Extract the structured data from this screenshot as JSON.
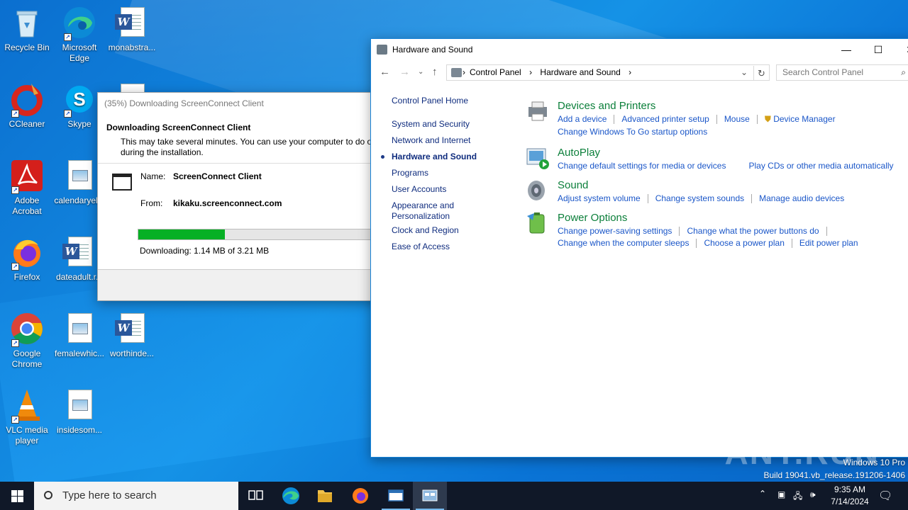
{
  "desktop": {
    "icons": [
      {
        "label": "Recycle Bin"
      },
      {
        "label": "Microsoft Edge"
      },
      {
        "label": "monabstra..."
      },
      {
        "label": "CCleaner"
      },
      {
        "label": "Skype"
      },
      {
        "label": "Adobe Acrobat"
      },
      {
        "label": "calendaryel..."
      },
      {
        "label": "Firefox"
      },
      {
        "label": "dateadult.r..."
      },
      {
        "label": "Google Chrome"
      },
      {
        "label": "femalewhic..."
      },
      {
        "label": "worthinde..."
      },
      {
        "label": "VLC media player"
      },
      {
        "label": "insidesom..."
      }
    ]
  },
  "download_dialog": {
    "title": "(35%) Downloading ScreenConnect Client",
    "heading": "Downloading ScreenConnect Client",
    "subtitle_line1": "This may take several minutes. You can use your computer to do ot",
    "subtitle_line2": "during the installation.",
    "name_label": "Name:",
    "name_value": "ScreenConnect Client",
    "from_label": "From:",
    "from_value": "kikaku.screenconnect.com",
    "progress_percent": 35,
    "status": "Downloading: 1.14 MB of 3.21 MB"
  },
  "control_panel": {
    "title": "Hardware and Sound",
    "breadcrumb": [
      "Control Panel",
      "Hardware and Sound"
    ],
    "search_placeholder": "Search Control Panel",
    "sidebar": {
      "home": "Control Panel Home",
      "items": [
        "System and Security",
        "Network and Internet",
        "Hardware and Sound",
        "Programs",
        "User Accounts",
        "Appearance and Personalization",
        "Clock and Region",
        "Ease of Access"
      ],
      "active_index": 2
    },
    "categories": [
      {
        "title": "Devices and Printers",
        "row1": [
          "Add a device",
          "Advanced printer setup",
          "Mouse",
          "Device Manager"
        ],
        "row2": [
          "Change Windows To Go startup options"
        ]
      },
      {
        "title": "AutoPlay",
        "row1": [
          "Change default settings for media or devices",
          "Play CDs or other media automatically"
        ],
        "row2": []
      },
      {
        "title": "Sound",
        "row1": [
          "Adjust system volume",
          "Change system sounds",
          "Manage audio devices"
        ],
        "row2": []
      },
      {
        "title": "Power Options",
        "row1": [
          "Change power-saving settings",
          "Change what the power buttons do"
        ],
        "row2": [
          "Change when the computer sleeps",
          "Choose a power plan",
          "Edit power plan"
        ]
      }
    ]
  },
  "watermark": {
    "text": "ANY.RUN",
    "edition": "Windows 10 Pro",
    "build": "Build 19041.vb_release.191206-1406"
  },
  "taskbar": {
    "search_placeholder": "Type here to search",
    "time": "9:35 AM",
    "date": "7/14/2024"
  },
  "colors": {
    "link": "#1a56c8",
    "category_title": "#0b7f3a",
    "progress": "#06b025",
    "taskbar": "#101828"
  }
}
